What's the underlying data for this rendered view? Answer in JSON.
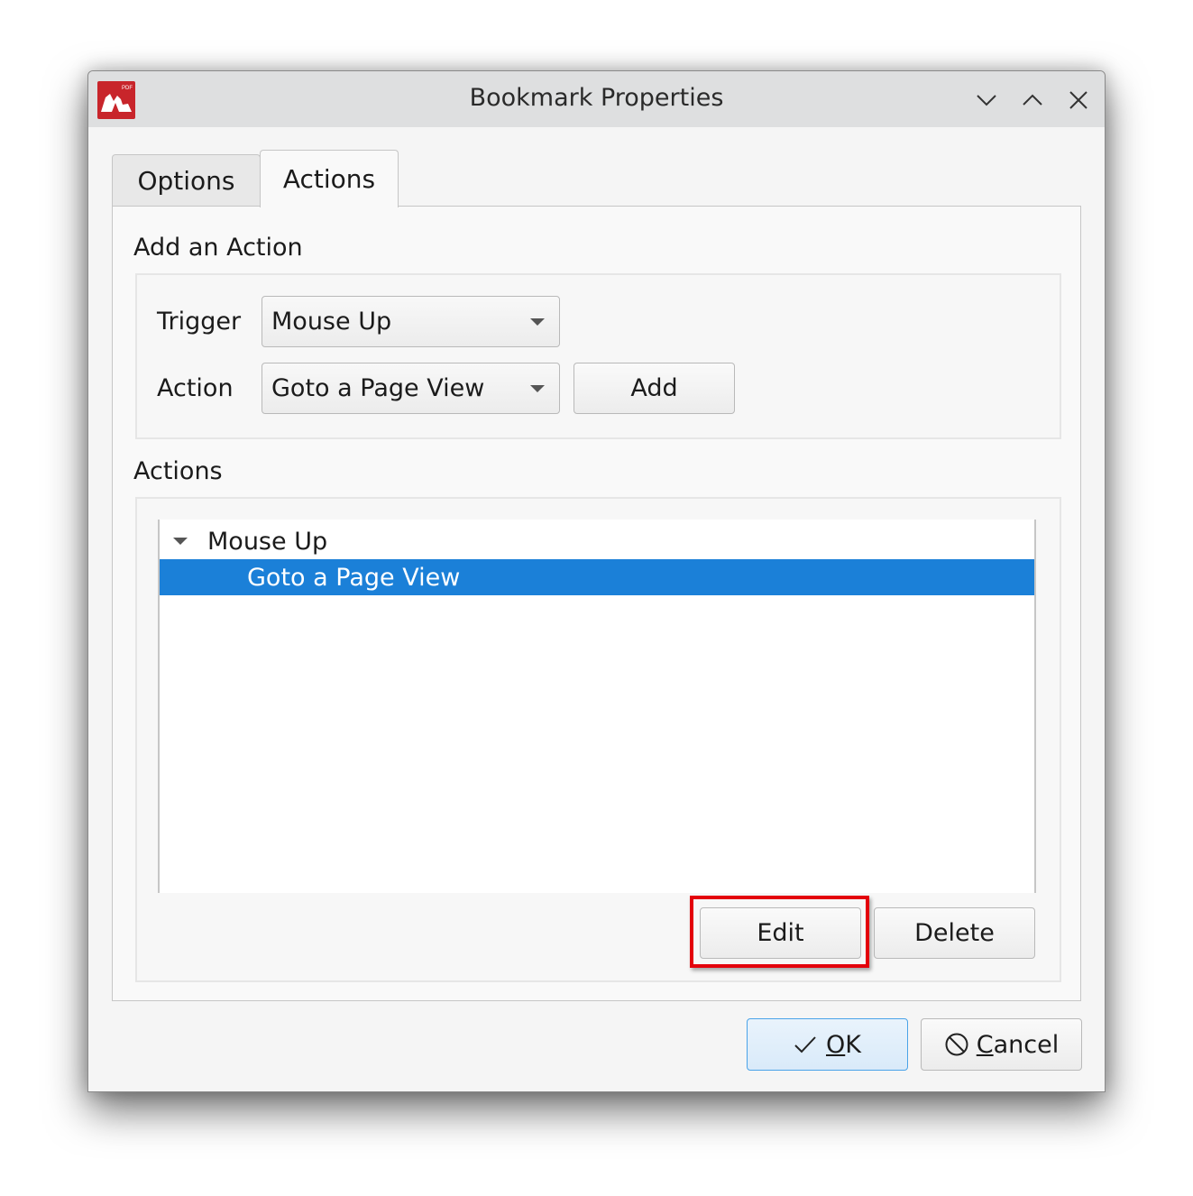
{
  "window": {
    "title": "Bookmark Properties",
    "app_icon": "pdf-app-logo-icon",
    "controls": [
      "minimize-icon",
      "maximize-icon",
      "close-icon"
    ]
  },
  "tabs": [
    {
      "label": "Options",
      "active": false
    },
    {
      "label": "Actions",
      "active": true
    }
  ],
  "add_action": {
    "section_label": "Add an Action",
    "trigger_label": "Trigger",
    "trigger_value": "Mouse Up",
    "action_label": "Action",
    "action_value": "Goto a Page View",
    "add_button": "Add"
  },
  "actions": {
    "section_label": "Actions",
    "tree": [
      {
        "label": "Mouse Up",
        "expanded": true,
        "children": [
          {
            "label": "Goto a Page View",
            "selected": true
          }
        ]
      }
    ],
    "edit_button": "Edit",
    "delete_button": "Delete"
  },
  "footer": {
    "ok_button": {
      "mnemonic": "O",
      "rest": "K",
      "icon": "checkmark-icon"
    },
    "cancel_button": {
      "mnemonic": "C",
      "rest": "ancel",
      "icon": "cancel-icon"
    }
  },
  "annotation": {
    "highlighted_element": "edit-button",
    "color": "#e3000b"
  },
  "colors": {
    "selection": "#1b80d8",
    "ok_border": "#4aa3e8",
    "app_icon": "#c8252b"
  }
}
